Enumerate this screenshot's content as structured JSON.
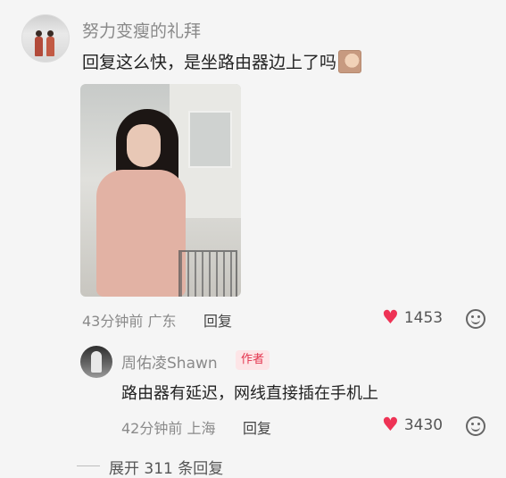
{
  "main_comment": {
    "username": "努力变瘦的礼拜",
    "text": "回复这么快，是坐路由器边上了吗",
    "sticker_icon": "face-sticker-emoji",
    "time": "43分钟前",
    "location": "广东",
    "reply_label": "回复",
    "likes": "1453"
  },
  "reply_comment": {
    "username": "周佑凌Shawn",
    "author_badge": "作者",
    "text": "路由器有延迟，网线直接插在手机上",
    "time": "42分钟前",
    "location": "上海",
    "reply_label": "回复",
    "likes": "3430"
  },
  "expand": {
    "label": "展开 311 条回复"
  },
  "colors": {
    "heart": "#ee3355",
    "author_badge_bg": "#fde5e7",
    "author_badge_text": "#e3344e",
    "meta_text": "#8a8a8a"
  }
}
